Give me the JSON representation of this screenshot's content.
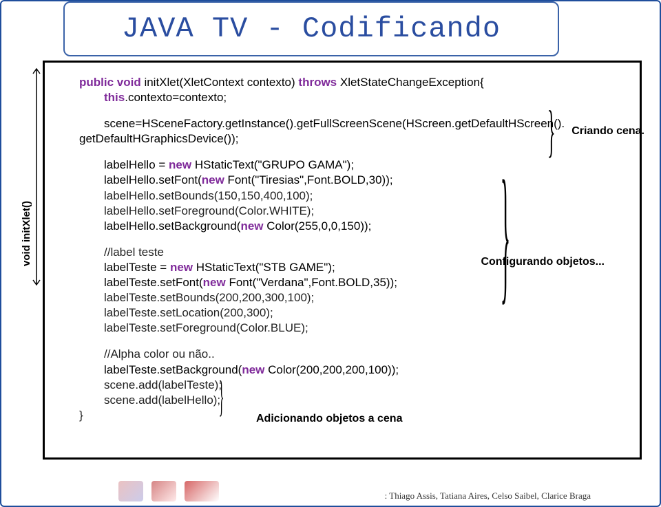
{
  "title": "JAVA TV - Codificando",
  "sideLabel": "void initXlet()",
  "code": {
    "l1a": "public void ",
    "l1b": "initXlet(XletContext contexto) ",
    "l1c": "throws ",
    "l1d": "XletStateChangeException{",
    "l2a": "this",
    "l2b": ".contexto=contexto;",
    "l3": "scene=HSceneFactory.getInstance().getFullScreenScene(HScreen.getDefaultHScreen().",
    "l4": "getDefaultHGraphicsDevice());",
    "l5a": "labelHello = ",
    "l5b": "new ",
    "l5c": "HStaticText(\"GRUPO GAMA\");",
    "l6a": "labelHello.setFont(",
    "l6b": "new ",
    "l6c": "Font(\"Tiresias\",Font.BOLD,30));",
    "l7": "labelHello.setBounds(150,150,400,100);",
    "l8": "labelHello.setForeground(Color.WHITE);",
    "l9a": "labelHello.setBackground(",
    "l9b": "new ",
    "l9c": "Color(255,0,0,150));",
    "l10": "//label teste",
    "l11a": "labelTeste = ",
    "l11b": "new ",
    "l11c": "HStaticText(\"STB GAME\");",
    "l12a": "labelTeste.setFont(",
    "l12b": "new ",
    "l12c": "Font(\"Verdana\",Font.BOLD,35));",
    "l13": "labelTeste.setBounds(200,200,300,100);",
    "l14": "labelTeste.setLocation(200,300);",
    "l15": "labelTeste.setForeground(Color.BLUE);",
    "l16": "//Alpha color ou não..",
    "l17a": "labelTeste.setBackground(",
    "l17b": "new ",
    "l17c": "Color(200,200,200,100));",
    "l18": "scene.add(labelTeste);",
    "l19": "scene.add(labelHello);",
    "l20": "}"
  },
  "annotations": {
    "a1": "Criando cena.",
    "a2": "Configurando objetos...",
    "a3": "Adicionando objetos a cena"
  },
  "footer": ": Thiago Assis, Tatiana Aires, Celso Saibel, Clarice Braga"
}
